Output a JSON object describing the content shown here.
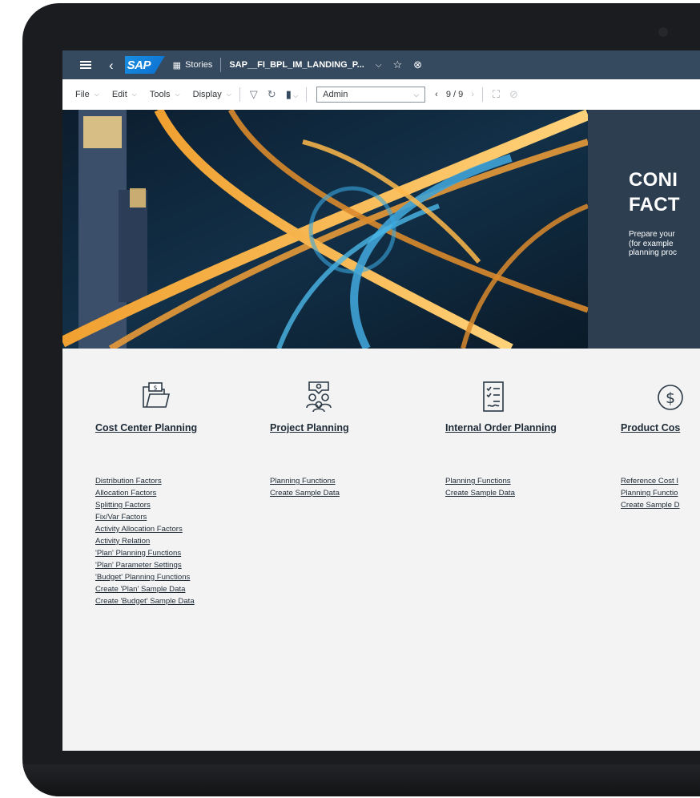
{
  "shellbar": {
    "logo": "SAP",
    "stories_label": "Stories",
    "story_title": "SAP__FI_BPL_IM_LANDING_P..."
  },
  "toolbar": {
    "file": "File",
    "edit": "Edit",
    "tools": "Tools",
    "display": "Display",
    "model_value": "Admin",
    "page_indicator": "9 / 9"
  },
  "hero": {
    "title": "CONI\nFACT",
    "description": "Prepare your\n(for example\nplanning proc"
  },
  "tiles": [
    {
      "title": "Cost Center Planning",
      "icon": "folder-money-icon",
      "links": [
        "Distribution Factors",
        "Allocation Factors",
        "Splitting Factors",
        "Fix/Var Factors",
        "Activity Allocation Factors",
        "Activity Relation",
        "'Plan' Planning Functions",
        "'Plan' Parameter Settings",
        "'Budget' Planning Functions",
        "Create 'Plan' Sample Data",
        "Create 'Budget' Sample Data"
      ]
    },
    {
      "title": "Project Planning",
      "icon": "team-idea-icon",
      "links": [
        "Planning Functions",
        "Create Sample Data"
      ]
    },
    {
      "title": "Internal Order Planning",
      "icon": "checklist-icon",
      "links": [
        "Planning Functions",
        "Create Sample Data"
      ]
    },
    {
      "title": "Product Cos",
      "icon": "dollar-circle-icon",
      "links": [
        "Reference Cost I",
        "Planning Functio",
        "Create Sample D"
      ]
    }
  ],
  "colors": {
    "shell": "#354a5f",
    "hero_panel": "#2c3e50",
    "page_bg": "#f3f3f3"
  }
}
